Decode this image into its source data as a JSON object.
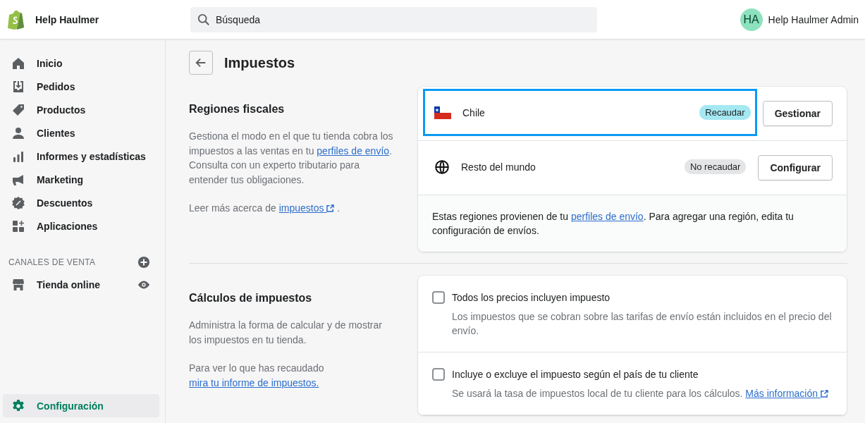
{
  "topbar": {
    "store_name": "Help Haulmer",
    "search": {
      "placeholder": "Búsqueda"
    },
    "user": {
      "initials": "HA",
      "name": "Help Haulmer Admin"
    }
  },
  "sidebar": {
    "items": [
      {
        "label": "Inicio",
        "selected": false
      },
      {
        "label": "Pedidos",
        "selected": false
      },
      {
        "label": "Productos",
        "selected": false
      },
      {
        "label": "Clientes",
        "selected": false
      },
      {
        "label": "Informes y estadísticas",
        "selected": false
      },
      {
        "label": "Marketing",
        "selected": false
      },
      {
        "label": "Descuentos",
        "selected": false
      },
      {
        "label": "Aplicaciones",
        "selected": false
      }
    ],
    "channels_heading": "CANALES DE VENTA",
    "channels": [
      {
        "label": "Tienda online",
        "selected": false
      }
    ],
    "footer_items": [
      {
        "label": "Configuración",
        "selected": true
      }
    ]
  },
  "page": {
    "title": "Impuestos",
    "sections": [
      {
        "title": "Regiones fiscales",
        "description": [
          [
            {
              "text": "Gestiona el modo en el que tu tienda cobra los impuestos a las ventas en tu "
            },
            {
              "link": "perfiles de envío"
            },
            {
              "text": ". Consulta con un experto tributario para entender tus obligaciones."
            }
          ],
          [
            {
              "text": "Leer más acerca de "
            },
            {
              "link": "impuestos",
              "external": true
            },
            {
              "text": " ."
            }
          ]
        ],
        "card": {
          "kind": "regions",
          "rows": [
            {
              "name": "Chile",
              "status": "Recaudar",
              "color": "#a4e8f2",
              "action": "Gestionar",
              "highlighted": true
            },
            {
              "name": "Resto del mundo",
              "status": "No recaudar",
              "color": "#e4e5e7",
              "action": "Configurar",
              "highlighted": false
            }
          ],
          "footer": [
            {
              "text": "Estas regiones provienen de tu "
            },
            {
              "link": "perfiles de envío"
            },
            {
              "text": ". Para agregar una región, edita tu configuración de envíos."
            }
          ]
        }
      },
      {
        "title": "Cálculos de impuestos",
        "description": [
          [
            {
              "text": "Administra la forma de calcular y de mostrar los impuestos en tu tienda."
            }
          ],
          [
            {
              "text": "Para ver lo que has recaudado "
            },
            {
              "link": "mira tu informe de impuestos."
            }
          ]
        ],
        "card": {
          "kind": "options",
          "options": [
            {
              "label": "Todos los precios incluyen impuesto",
              "checked": false,
              "help": [
                {
                  "text": "Los impuestos que se cobran sobre las tarifas de envío están incluidos en el precio del envío."
                }
              ]
            },
            {
              "label": "Incluye o excluye el impuesto según el país de tu cliente",
              "checked": false,
              "help": [
                {
                  "text": "Se usará la tasa de impuestos local de tu cliente para los cálculos. "
                },
                {
                  "link": "Más información",
                  "external": true
                }
              ]
            }
          ]
        }
      }
    ]
  }
}
